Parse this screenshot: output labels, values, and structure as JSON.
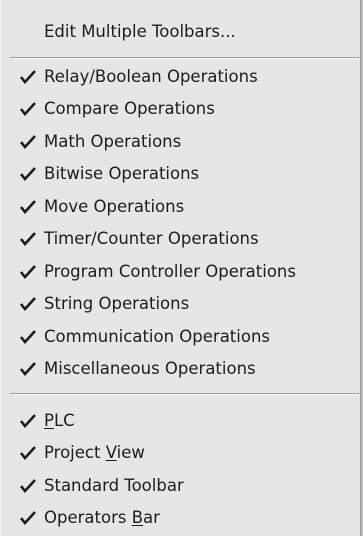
{
  "menu": {
    "header": {
      "label": "Edit Multiple Toolbars..."
    },
    "operations": [
      {
        "label": "Relay/Boolean Operations",
        "checked": true
      },
      {
        "label": "Compare Operations",
        "checked": true
      },
      {
        "label": "Math Operations",
        "checked": true
      },
      {
        "label": "Bitwise Operations",
        "checked": true
      },
      {
        "label": "Move Operations",
        "checked": true
      },
      {
        "label": "Timer/Counter Operations",
        "checked": true
      },
      {
        "label": "Program Controller Operations",
        "checked": true
      },
      {
        "label": "String Operations",
        "checked": true
      },
      {
        "label": "Communication Operations",
        "checked": true
      },
      {
        "label": "Miscellaneous Operations",
        "checked": true
      }
    ],
    "views": [
      {
        "label": "PLC",
        "underline_pre": "",
        "underline_char": "P",
        "underline_post": "LC",
        "checked": true
      },
      {
        "label": "Project View",
        "underline_pre": "Project ",
        "underline_char": "V",
        "underline_post": "iew",
        "checked": true
      },
      {
        "label": "Standard Toolbar",
        "underline_pre": "Standard Toolbar",
        "underline_char": "",
        "underline_post": "",
        "checked": true
      },
      {
        "label": "Operators Bar",
        "underline_pre": "Operators ",
        "underline_char": "B",
        "underline_post": "ar",
        "checked": true
      }
    ]
  },
  "colors": {
    "menu_background": "#e6e6e6",
    "text": "#1c1c1c",
    "separator": "#9c9c9c"
  },
  "icons": {
    "check": "checkmark-icon"
  }
}
